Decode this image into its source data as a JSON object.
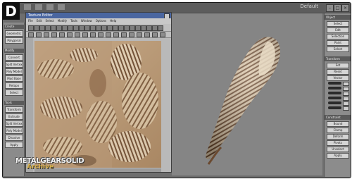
{
  "badge": {
    "letter": "D"
  },
  "app": {
    "title": "Default"
  },
  "texture_window": {
    "title": "Texture Editor",
    "menu": [
      "File",
      "Edit",
      "Select",
      "Modify",
      "Tools",
      "Window",
      "Options",
      "Help"
    ]
  },
  "left_panel": {
    "sections": [
      {
        "heading": "Create",
        "buttons": [
          "Geometric",
          "Polygonal"
        ]
      },
      {
        "heading": "Modify",
        "buttons": [
          "Convert",
          "Split Vertex",
          "Poly Model",
          "Mod Base",
          "Retopo",
          "Select"
        ]
      },
      {
        "heading": "Tools",
        "buttons": [
          "Transform",
          "Extrude",
          "Split Vertex",
          "Poly Model",
          "Dissolve",
          "Apply"
        ]
      }
    ]
  },
  "right_panel": {
    "sections": [
      {
        "heading": "Object",
        "buttons": [
          "Select",
          "Edit",
          "Selection",
          "Paint",
          "Select"
        ]
      },
      {
        "heading": "Transform",
        "buttons": [
          "Set",
          "Reset",
          "Vector"
        ]
      },
      {
        "heading": "Constraint",
        "buttons": [
          "Bound",
          "Clamp",
          "Deform",
          "Pivots",
          "Unselect",
          "Apply"
        ]
      }
    ]
  },
  "watermark": {
    "line1": "METALGEARSOLID",
    "line2": "Archive"
  },
  "colors": {
    "viewport_bg": "#858585",
    "title_blue": "#4a66a0",
    "shell_light": "#d8c3a4",
    "shell_dark": "#6b4a30"
  }
}
